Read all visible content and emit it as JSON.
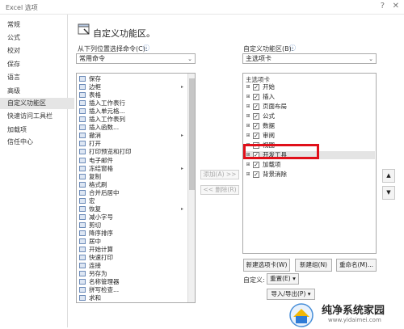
{
  "window": {
    "title": "Excel 选项",
    "help_glyph": "?",
    "close_glyph": "✕"
  },
  "sidebar": {
    "items": [
      "常规",
      "公式",
      "校对",
      "保存",
      "语言",
      "高级",
      "自定义功能区",
      "快速访问工具栏",
      "加载项",
      "信任中心"
    ],
    "selected_index": 6
  },
  "header": {
    "title": "自定义功能区。"
  },
  "commands": {
    "label": "从下列位置选择命令(C):",
    "info": "ⓘ",
    "dropdown_value": "常用命令",
    "items": [
      {
        "label": "保存",
        "has_submenu": false
      },
      {
        "label": "边框",
        "has_submenu": true
      },
      {
        "label": "表格",
        "has_submenu": false
      },
      {
        "label": "插入工作表行",
        "has_submenu": false
      },
      {
        "label": "插入单元格...",
        "has_submenu": false
      },
      {
        "label": "插入工作表列",
        "has_submenu": false
      },
      {
        "label": "插入函数...",
        "has_submenu": false
      },
      {
        "label": "撤消",
        "has_submenu": true
      },
      {
        "label": "打开",
        "has_submenu": false
      },
      {
        "label": "打印预览和打印",
        "has_submenu": false
      },
      {
        "label": "电子邮件",
        "has_submenu": false
      },
      {
        "label": "冻结窗格",
        "has_submenu": true
      },
      {
        "label": "复制",
        "has_submenu": false
      },
      {
        "label": "格式刷",
        "has_submenu": false
      },
      {
        "label": "合并后居中",
        "has_submenu": false
      },
      {
        "label": "宏",
        "has_submenu": false
      },
      {
        "label": "恢复",
        "has_submenu": true
      },
      {
        "label": "减小字号",
        "has_submenu": false
      },
      {
        "label": "剪切",
        "has_submenu": false
      },
      {
        "label": "降序排序",
        "has_submenu": false
      },
      {
        "label": "居中",
        "has_submenu": false
      },
      {
        "label": "开始计算",
        "has_submenu": false
      },
      {
        "label": "快速打印",
        "has_submenu": false
      },
      {
        "label": "连接",
        "has_submenu": false
      },
      {
        "label": "另存为",
        "has_submenu": false
      },
      {
        "label": "名称管理器",
        "has_submenu": false
      },
      {
        "label": "拼写检查...",
        "has_submenu": false
      },
      {
        "label": "求和",
        "has_submenu": false
      }
    ]
  },
  "middle_buttons": {
    "add": "添加(A) >>",
    "remove": "<< 删除(R)"
  },
  "ribbon": {
    "label": "自定义功能区(B):",
    "info": "ⓘ",
    "dropdown_value": "主选项卡",
    "tree_header": "主选项卡",
    "tabs": [
      {
        "label": "开始",
        "checked": true,
        "highlight": false
      },
      {
        "label": "插入",
        "checked": true,
        "highlight": false
      },
      {
        "label": "页面布局",
        "checked": true,
        "highlight": false
      },
      {
        "label": "公式",
        "checked": true,
        "highlight": false
      },
      {
        "label": "数据",
        "checked": true,
        "highlight": false
      },
      {
        "label": "审阅",
        "checked": true,
        "highlight": false
      },
      {
        "label": "视图",
        "checked": true,
        "highlight": false
      },
      {
        "label": "开发工具",
        "checked": true,
        "highlight": true
      },
      {
        "label": "加载项",
        "checked": true,
        "highlight": false
      },
      {
        "label": "背景消除",
        "checked": true,
        "highlight": false
      }
    ],
    "expand_glyph": "⊞",
    "check_glyph": "✓",
    "move_up": "▲",
    "move_down": "▼"
  },
  "bottom": {
    "new_tab": "新建选项卡(W)",
    "new_group": "新建组(N)",
    "rename": "重命名(M)...",
    "customize_label": "自定义:",
    "reset": "重置(E) ▾",
    "import_export": "导入/导出(P) ▾"
  },
  "watermark": {
    "text": "纯净系统家园",
    "url": "www.yidaimei.com"
  },
  "colors": {
    "highlight_box": "#e0101a",
    "selected_nav": "#e5e5e5"
  }
}
